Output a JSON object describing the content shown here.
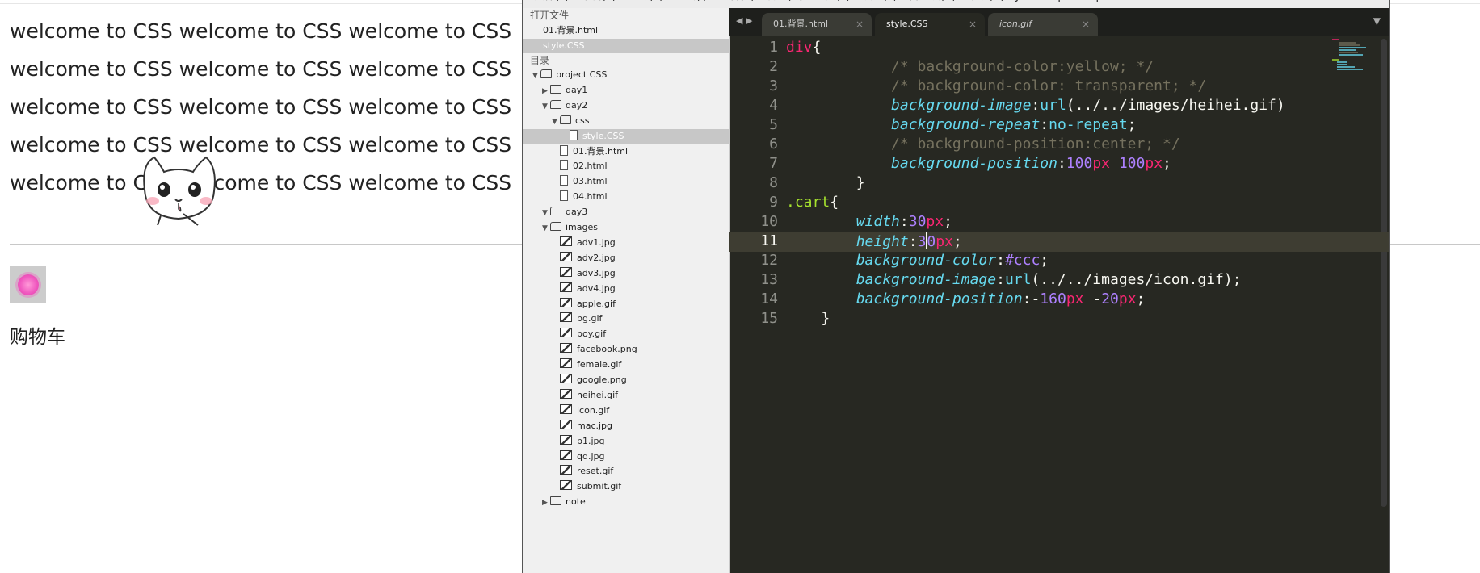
{
  "browser": {
    "welcome_lines": [
      "welcome to CSS welcome to CSS welcome to CSS",
      "welcome to CSS welcome to CSS welcome to CSS",
      "welcome to CSS welcome to CSS welcome to CSS",
      "welcome to CSS welcome to CSS welcome to CSS",
      "welcome to CSS welcome to CSS welcome to CSS"
    ],
    "cart_label": "购物车"
  },
  "editor": {
    "menu": [
      "文件(F)",
      "编辑(E)",
      "选择(S)",
      "查找(I)",
      "查看(V)",
      "转到(G)",
      "工具(T)",
      "项目(P)",
      "首选项(N)",
      "帮助(H)",
      "JavaScript Completions Tools"
    ],
    "sidebar": {
      "open_files_header": "打开文件",
      "open_files": [
        "01.背景.html",
        "style.CSS"
      ],
      "folders_header": "目录",
      "tree": [
        {
          "label": "project CSS",
          "type": "folder-open",
          "depth": 0
        },
        {
          "label": "day1",
          "type": "folder-closed",
          "depth": 1
        },
        {
          "label": "day2",
          "type": "folder-open",
          "depth": 1
        },
        {
          "label": "css",
          "type": "folder-open",
          "depth": 2
        },
        {
          "label": "style.CSS",
          "type": "file",
          "depth": 3,
          "selected": true
        },
        {
          "label": "01.背景.html",
          "type": "file",
          "depth": 2
        },
        {
          "label": "02.html",
          "type": "file",
          "depth": 2
        },
        {
          "label": "03.html",
          "type": "file",
          "depth": 2
        },
        {
          "label": "04.html",
          "type": "file",
          "depth": 2
        },
        {
          "label": "day3",
          "type": "folder-open",
          "depth": 1
        },
        {
          "label": "images",
          "type": "folder-open",
          "depth": 1
        },
        {
          "label": "adv1.jpg",
          "type": "image",
          "depth": 2
        },
        {
          "label": "adv2.jpg",
          "type": "image",
          "depth": 2
        },
        {
          "label": "adv3.jpg",
          "type": "image",
          "depth": 2
        },
        {
          "label": "adv4.jpg",
          "type": "image",
          "depth": 2
        },
        {
          "label": "apple.gif",
          "type": "image",
          "depth": 2
        },
        {
          "label": "bg.gif",
          "type": "image",
          "depth": 2
        },
        {
          "label": "boy.gif",
          "type": "image",
          "depth": 2
        },
        {
          "label": "facebook.png",
          "type": "image",
          "depth": 2
        },
        {
          "label": "female.gif",
          "type": "image",
          "depth": 2
        },
        {
          "label": "google.png",
          "type": "image",
          "depth": 2
        },
        {
          "label": "heihei.gif",
          "type": "image",
          "depth": 2
        },
        {
          "label": "icon.gif",
          "type": "image",
          "depth": 2
        },
        {
          "label": "mac.jpg",
          "type": "image",
          "depth": 2
        },
        {
          "label": "p1.jpg",
          "type": "image",
          "depth": 2
        },
        {
          "label": "qq.jpg",
          "type": "image",
          "depth": 2
        },
        {
          "label": "reset.gif",
          "type": "image",
          "depth": 2
        },
        {
          "label": "submit.gif",
          "type": "image",
          "depth": 2
        },
        {
          "label": "note",
          "type": "folder-closed",
          "depth": 1
        }
      ]
    },
    "tabs": [
      {
        "label": "01.背景.html",
        "state": "inactive"
      },
      {
        "label": "style.CSS",
        "state": "active"
      },
      {
        "label": "icon.gif",
        "state": "inactive-italic"
      }
    ],
    "tab_close_glyph": "×",
    "current_line": 11,
    "code_lines": [
      [
        {
          "t": "div",
          "c": "kw"
        },
        {
          "t": "{",
          "c": ""
        }
      ],
      [
        {
          "t": "            ",
          "c": ""
        },
        {
          "t": "/* background-color:yellow; */",
          "c": "cmt"
        }
      ],
      [
        {
          "t": "            ",
          "c": ""
        },
        {
          "t": "/* background-color: transparent; */",
          "c": "cmt"
        }
      ],
      [
        {
          "t": "            ",
          "c": ""
        },
        {
          "t": "background-image",
          "c": "prop"
        },
        {
          "t": ":",
          "c": ""
        },
        {
          "t": "url",
          "c": "val"
        },
        {
          "t": "(../../images/heihei.gif)",
          "c": ""
        }
      ],
      [
        {
          "t": "            ",
          "c": ""
        },
        {
          "t": "background-repeat",
          "c": "prop"
        },
        {
          "t": ":",
          "c": ""
        },
        {
          "t": "no-repeat",
          "c": "val"
        },
        {
          "t": ";",
          "c": ""
        }
      ],
      [
        {
          "t": "            ",
          "c": ""
        },
        {
          "t": "/* background-position:center; */",
          "c": "cmt"
        }
      ],
      [
        {
          "t": "            ",
          "c": ""
        },
        {
          "t": "background-position",
          "c": "prop"
        },
        {
          "t": ":",
          "c": ""
        },
        {
          "t": "100",
          "c": "num"
        },
        {
          "t": "px",
          "c": "unit"
        },
        {
          "t": " ",
          "c": ""
        },
        {
          "t": "100",
          "c": "num"
        },
        {
          "t": "px",
          "c": "unit"
        },
        {
          "t": ";",
          "c": ""
        }
      ],
      [
        {
          "t": "        ",
          "c": ""
        },
        {
          "t": "}",
          "c": ""
        }
      ],
      [
        {
          "t": ".cart",
          "c": "sel"
        },
        {
          "t": "{",
          "c": ""
        }
      ],
      [
        {
          "t": "        ",
          "c": ""
        },
        {
          "t": "width",
          "c": "prop"
        },
        {
          "t": ":",
          "c": ""
        },
        {
          "t": "30",
          "c": "num"
        },
        {
          "t": "px",
          "c": "unit"
        },
        {
          "t": ";",
          "c": ""
        }
      ],
      [
        {
          "t": "        ",
          "c": ""
        },
        {
          "t": "height",
          "c": "prop"
        },
        {
          "t": ":",
          "c": ""
        },
        {
          "t": "3",
          "c": "num"
        },
        {
          "t": "|",
          "c": "caret"
        },
        {
          "t": "0",
          "c": "num"
        },
        {
          "t": "px",
          "c": "unit"
        },
        {
          "t": ";",
          "c": ""
        }
      ],
      [
        {
          "t": "        ",
          "c": ""
        },
        {
          "t": "background-color",
          "c": "prop"
        },
        {
          "t": ":",
          "c": ""
        },
        {
          "t": "#ccc",
          "c": "num"
        },
        {
          "t": ";",
          "c": ""
        }
      ],
      [
        {
          "t": "        ",
          "c": ""
        },
        {
          "t": "background-image",
          "c": "prop"
        },
        {
          "t": ":",
          "c": ""
        },
        {
          "t": "url",
          "c": "val"
        },
        {
          "t": "(../../images/icon.gif);",
          "c": ""
        }
      ],
      [
        {
          "t": "        ",
          "c": ""
        },
        {
          "t": "background-position",
          "c": "prop"
        },
        {
          "t": ":",
          "c": ""
        },
        {
          "t": "-",
          "c": ""
        },
        {
          "t": "160",
          "c": "num"
        },
        {
          "t": "px",
          "c": "unit"
        },
        {
          "t": " -",
          "c": ""
        },
        {
          "t": "20",
          "c": "num"
        },
        {
          "t": "px",
          "c": "unit"
        },
        {
          "t": ";",
          "c": ""
        }
      ],
      [
        {
          "t": "    ",
          "c": ""
        },
        {
          "t": "}",
          "c": ""
        }
      ]
    ],
    "dropdown_glyph": "▼",
    "nav_glyphs": "◀ ▶"
  },
  "colors": {
    "editor_bg": "#272822",
    "keyword": "#f92672",
    "selector": "#a6e22e",
    "property": "#66d9ef",
    "number": "#ae81ff",
    "comment": "#75715e"
  }
}
